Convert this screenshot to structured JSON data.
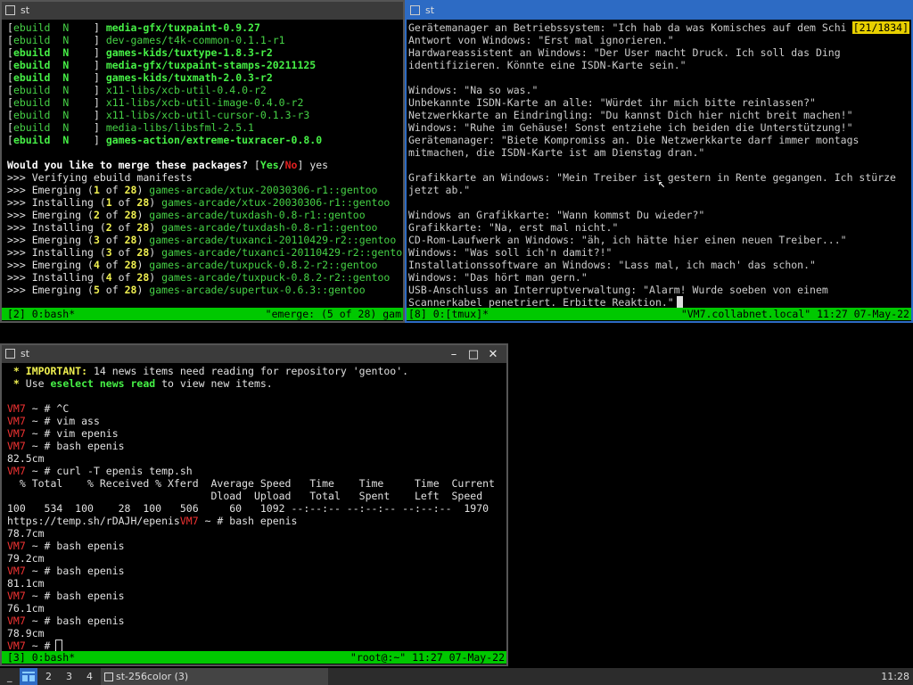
{
  "win_top_left": {
    "title": "st",
    "lines": [
      [
        [
          "[",
          "w"
        ],
        [
          "ebuild  N    ",
          "g"
        ],
        [
          "] ",
          "w"
        ],
        [
          "media-gfx/tuxpaint-0.9.27",
          "gb"
        ]
      ],
      [
        [
          "[",
          "w"
        ],
        [
          "ebuild  N    ",
          "g"
        ],
        [
          "] ",
          "w"
        ],
        [
          "dev-games/t4k-common-0.1.1-r1",
          "g"
        ]
      ],
      [
        [
          "[",
          "w"
        ],
        [
          "ebuild  N    ",
          "gb"
        ],
        [
          "] ",
          "w"
        ],
        [
          "games-kids/tuxtype-1.8.3-r2",
          "gb"
        ]
      ],
      [
        [
          "[",
          "w"
        ],
        [
          "ebuild  N    ",
          "gb"
        ],
        [
          "] ",
          "w"
        ],
        [
          "media-gfx/tuxpaint-stamps-20211125",
          "gb"
        ]
      ],
      [
        [
          "[",
          "w"
        ],
        [
          "ebuild  N    ",
          "gb"
        ],
        [
          "] ",
          "w"
        ],
        [
          "games-kids/tuxmath-2.0.3-r2",
          "gb"
        ]
      ],
      [
        [
          "[",
          "w"
        ],
        [
          "ebuild  N    ",
          "g"
        ],
        [
          "] ",
          "w"
        ],
        [
          "x11-libs/xcb-util-0.4.0-r2",
          "g"
        ]
      ],
      [
        [
          "[",
          "w"
        ],
        [
          "ebuild  N    ",
          "g"
        ],
        [
          "] ",
          "w"
        ],
        [
          "x11-libs/xcb-util-image-0.4.0-r2",
          "g"
        ]
      ],
      [
        [
          "[",
          "w"
        ],
        [
          "ebuild  N    ",
          "g"
        ],
        [
          "] ",
          "w"
        ],
        [
          "x11-libs/xcb-util-cursor-0.1.3-r3",
          "g"
        ]
      ],
      [
        [
          "[",
          "w"
        ],
        [
          "ebuild  N    ",
          "g"
        ],
        [
          "] ",
          "w"
        ],
        [
          "media-libs/libsfml-2.5.1",
          "g"
        ]
      ],
      [
        [
          "[",
          "w"
        ],
        [
          "ebuild  N    ",
          "gb"
        ],
        [
          "] ",
          "w"
        ],
        [
          "games-action/extreme-tuxracer-0.8.0",
          "gb"
        ]
      ],
      [
        [
          "",
          ""
        ]
      ],
      [
        [
          "Would you like to merge these packages? ",
          "wb"
        ],
        [
          "[",
          "w"
        ],
        [
          "Yes",
          "gb"
        ],
        [
          "/",
          "w"
        ],
        [
          "No",
          "rb"
        ],
        [
          "] yes",
          "w"
        ]
      ],
      [
        [
          ">>> Verifying ebuild manifests",
          "w"
        ]
      ],
      [
        [
          ">>> Emerging (",
          "w"
        ],
        [
          "1",
          "yb"
        ],
        [
          " of ",
          "w"
        ],
        [
          "28",
          "yb"
        ],
        [
          ") ",
          "w"
        ],
        [
          "games-arcade/xtux-20030306-r1::gentoo",
          "g"
        ]
      ],
      [
        [
          ">>> Installing (",
          "w"
        ],
        [
          "1",
          "yb"
        ],
        [
          " of ",
          "w"
        ],
        [
          "28",
          "yb"
        ],
        [
          ") ",
          "w"
        ],
        [
          "games-arcade/xtux-20030306-r1::gentoo",
          "g"
        ]
      ],
      [
        [
          ">>> Emerging (",
          "w"
        ],
        [
          "2",
          "yb"
        ],
        [
          " of ",
          "w"
        ],
        [
          "28",
          "yb"
        ],
        [
          ") ",
          "w"
        ],
        [
          "games-arcade/tuxdash-0.8-r1::gentoo",
          "g"
        ]
      ],
      [
        [
          ">>> Installing (",
          "w"
        ],
        [
          "2",
          "yb"
        ],
        [
          " of ",
          "w"
        ],
        [
          "28",
          "yb"
        ],
        [
          ") ",
          "w"
        ],
        [
          "games-arcade/tuxdash-0.8-r1::gentoo",
          "g"
        ]
      ],
      [
        [
          ">>> Emerging (",
          "w"
        ],
        [
          "3",
          "yb"
        ],
        [
          " of ",
          "w"
        ],
        [
          "28",
          "yb"
        ],
        [
          ") ",
          "w"
        ],
        [
          "games-arcade/tuxanci-20110429-r2::gentoo",
          "g"
        ]
      ],
      [
        [
          ">>> Installing (",
          "w"
        ],
        [
          "3",
          "yb"
        ],
        [
          " of ",
          "w"
        ],
        [
          "28",
          "yb"
        ],
        [
          ") ",
          "w"
        ],
        [
          "games-arcade/tuxanci-20110429-r2::gento",
          "g"
        ]
      ],
      [
        [
          ">>> Emerging (",
          "w"
        ],
        [
          "4",
          "yb"
        ],
        [
          " of ",
          "w"
        ],
        [
          "28",
          "yb"
        ],
        [
          ") ",
          "w"
        ],
        [
          "games-arcade/tuxpuck-0.8.2-r2::gentoo",
          "g"
        ]
      ],
      [
        [
          ">>> Installing (",
          "w"
        ],
        [
          "4",
          "yb"
        ],
        [
          " of ",
          "w"
        ],
        [
          "28",
          "yb"
        ],
        [
          ") ",
          "w"
        ],
        [
          "games-arcade/tuxpuck-0.8.2-r2::gentoo",
          "g"
        ]
      ],
      [
        [
          ">>> Emerging (",
          "w"
        ],
        [
          "5",
          "yb"
        ],
        [
          " of ",
          "w"
        ],
        [
          "28",
          "yb"
        ],
        [
          ") ",
          "w"
        ],
        [
          "games-arcade/supertux-0.6.3::gentoo",
          "g"
        ]
      ]
    ],
    "status_left": "[2] 0:bash*",
    "status_right": "\"emerge: (5 of 28) gam"
  },
  "win_top_right": {
    "title": "st",
    "badge": "[21/1834]",
    "lines": [
      "Gerätemanager an Betriebssystem: \"Ich hab da was Komisches auf dem Schi",
      "Antwort von Windows: \"Erst mal ignorieren.\"",
      "Hardwareassistent an Windows: \"Der User macht Druck. Ich soll das Ding",
      "identifizieren. Könnte eine ISDN-Karte sein.\"",
      "",
      "Windows: \"Na so was.\"",
      "Unbekannte ISDN-Karte an alle: \"Würdet ihr mich bitte reinlassen?\"",
      "Netzwerkkarte an Eindringling: \"Du kannst Dich hier nicht breit machen!\"",
      "Windows: \"Ruhe im Gehäuse! Sonst entziehe ich beiden die Unterstützung!\"",
      "Gerätemanager: \"Biete Kompromiss an. Die Netzwerkkarte darf immer montags",
      "mitmachen, die ISDN-Karte ist am Dienstag dran.\"",
      "",
      "Grafikkarte an Windows: \"Mein Treiber ist gestern in Rente gegangen. Ich stürze",
      "jetzt ab.\"",
      "",
      "Windows an Grafikkarte: \"Wann kommst Du wieder?\"",
      "Grafikkarte: \"Na, erst mal nicht.\"",
      "CD-Rom-Laufwerk an Windows: \"äh, ich hätte hier einen neuen Treiber...\"",
      "Windows: \"Was soll ich'n damit?!\"",
      "Installationssoftware an Windows: \"Lass mal, ich mach' das schon.\"",
      "Windows: \"Das hört man gern.\"",
      "USB-Anschluss an Interruptverwaltung: \"Alarm! Wurde soeben von einem",
      "Scannerkabel penetriert. Erbitte Reaktion.\""
    ],
    "status_left": "[8] 0:[tmux]*",
    "status_right": "\"VM7.collabnet.local\" 11:27 07-May-22"
  },
  "win_bottom": {
    "title": "st",
    "lines": [
      [
        [
          " * ",
          "yb"
        ],
        [
          "IMPORTANT:",
          "yb"
        ],
        [
          " 14 news items need reading for repository 'gentoo'.",
          "w"
        ]
      ],
      [
        [
          " * ",
          "yb"
        ],
        [
          "Use ",
          "w"
        ],
        [
          "eselect news read",
          "gb"
        ],
        [
          " to view new items.",
          "w"
        ]
      ],
      [
        [
          "",
          ""
        ]
      ],
      [
        [
          "VM7",
          "red"
        ],
        [
          " ~ # ^C",
          "w"
        ]
      ],
      [
        [
          "VM7",
          "red"
        ],
        [
          " ~ # vim ass",
          "w"
        ]
      ],
      [
        [
          "VM7",
          "red"
        ],
        [
          " ~ # vim epenis",
          "w"
        ]
      ],
      [
        [
          "VM7",
          "red"
        ],
        [
          " ~ # bash epenis",
          "w"
        ]
      ],
      [
        [
          "82.5cm",
          "w"
        ]
      ],
      [
        [
          "VM7",
          "red"
        ],
        [
          " ~ # curl -T epenis temp.sh",
          "w"
        ]
      ],
      [
        [
          "  % Total    % Received % Xferd  Average Speed   Time    Time     Time  Current",
          "w"
        ]
      ],
      [
        [
          "                                 Dload  Upload   Total   Spent    Left  Speed",
          "w"
        ]
      ],
      [
        [
          "100   534  100    28  100   506     60   1092 --:--:-- --:--:-- --:--:--  1970",
          "w"
        ]
      ],
      [
        [
          "https://temp.sh/rDAJH/epenis",
          "w"
        ],
        [
          "VM7",
          "red"
        ],
        [
          " ~ # bash epenis",
          "w"
        ]
      ],
      [
        [
          "78.7cm",
          "w"
        ]
      ],
      [
        [
          "VM7",
          "red"
        ],
        [
          " ~ # bash epenis",
          "w"
        ]
      ],
      [
        [
          "79.2cm",
          "w"
        ]
      ],
      [
        [
          "VM7",
          "red"
        ],
        [
          " ~ # bash epenis",
          "w"
        ]
      ],
      [
        [
          "81.1cm",
          "w"
        ]
      ],
      [
        [
          "VM7",
          "red"
        ],
        [
          " ~ # bash epenis",
          "w"
        ]
      ],
      [
        [
          "76.1cm",
          "w"
        ]
      ],
      [
        [
          "VM7",
          "red"
        ],
        [
          " ~ # bash epenis",
          "w"
        ]
      ],
      [
        [
          "78.9cm",
          "w"
        ]
      ],
      [
        [
          "VM7",
          "red"
        ],
        [
          " ~ # ",
          "w"
        ]
      ]
    ],
    "status_left": "[3] 0:bash*",
    "status_right": "\"root@:~\" 11:27 07-May-22"
  },
  "taskbar": {
    "workspaces": [
      "_",
      "1",
      "2",
      "3",
      "4"
    ],
    "task_label": "st-256color (3)",
    "clock": "11:28"
  },
  "colors": {
    "status_green": "#00c800",
    "accent_blue": "#2d6bc4",
    "prompt_red": "#f03232"
  }
}
